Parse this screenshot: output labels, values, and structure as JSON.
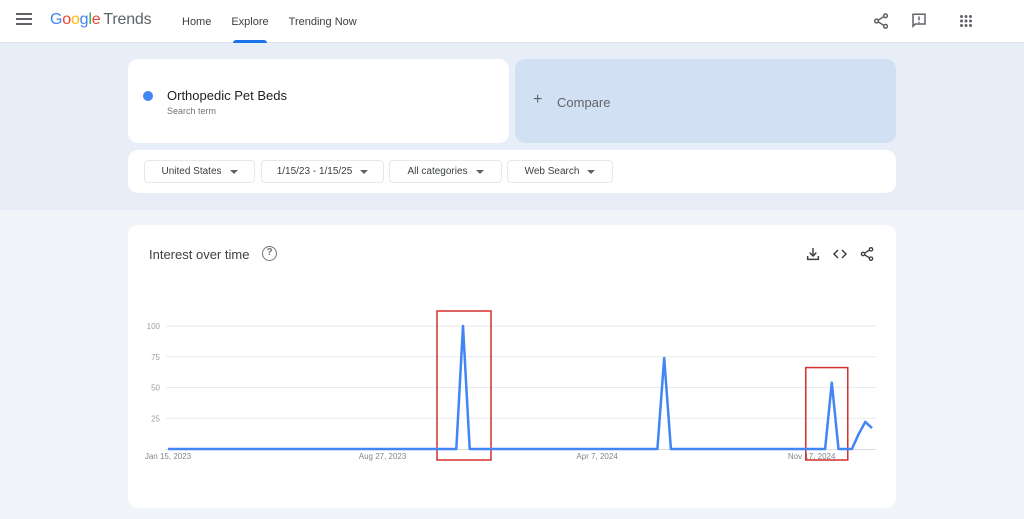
{
  "header": {
    "logo": {
      "google": [
        "G",
        "o",
        "o",
        "g",
        "l",
        "e"
      ],
      "product": "Trends"
    },
    "nav": [
      {
        "label": "Home",
        "active": false
      },
      {
        "label": "Explore",
        "active": true
      },
      {
        "label": "Trending Now",
        "active": false
      }
    ],
    "icons": [
      "share-icon",
      "feedback-icon",
      "apps-grid-icon"
    ]
  },
  "search": {
    "term": "Orthopedic Pet Beds",
    "term_type": "Search term",
    "term_color": "#4285f4",
    "compare_label": "Compare"
  },
  "filters": [
    {
      "label": "United States"
    },
    {
      "label": "1/15/23 - 1/15/25"
    },
    {
      "label": "All categories"
    },
    {
      "label": "Web Search"
    }
  ],
  "interest_card": {
    "title": "Interest over time",
    "icons": [
      "help-icon",
      "download-icon",
      "embed-icon",
      "share-icon"
    ]
  },
  "chart_data": {
    "type": "line",
    "title": "Interest over time",
    "xlabel": "",
    "ylabel": "",
    "ylim": [
      0,
      100
    ],
    "yticks": [
      25,
      50,
      75,
      100
    ],
    "grid": true,
    "x_tick_labels": [
      {
        "label": "Jan 15, 2023",
        "index": 0
      },
      {
        "label": "Aug 27, 2023",
        "index": 32
      },
      {
        "label": "Apr 7, 2024",
        "index": 64
      },
      {
        "label": "Nov 17, 2024",
        "index": 96
      }
    ],
    "series": [
      {
        "name": "Orthopedic Pet Beds",
        "color": "#4285f4",
        "values": [
          0,
          0,
          0,
          0,
          0,
          0,
          0,
          0,
          0,
          0,
          0,
          0,
          0,
          0,
          0,
          0,
          0,
          0,
          0,
          0,
          0,
          0,
          0,
          0,
          0,
          0,
          0,
          0,
          0,
          0,
          0,
          0,
          0,
          0,
          0,
          0,
          0,
          0,
          0,
          0,
          0,
          0,
          0,
          0,
          100,
          0,
          0,
          0,
          0,
          0,
          0,
          0,
          0,
          0,
          0,
          0,
          0,
          0,
          0,
          0,
          0,
          0,
          0,
          0,
          0,
          0,
          0,
          0,
          0,
          0,
          0,
          0,
          0,
          0,
          74,
          0,
          0,
          0,
          0,
          0,
          0,
          0,
          0,
          0,
          0,
          0,
          0,
          0,
          0,
          0,
          0,
          0,
          0,
          0,
          0,
          0,
          0,
          0,
          0,
          54,
          0,
          0,
          0,
          12,
          22,
          17
        ]
      }
    ],
    "annotations": [
      {
        "type": "highlight-box",
        "color": "#d32f2f",
        "around_index": 44
      },
      {
        "type": "highlight-box",
        "color": "#d32f2f",
        "around_index": 99
      }
    ]
  }
}
